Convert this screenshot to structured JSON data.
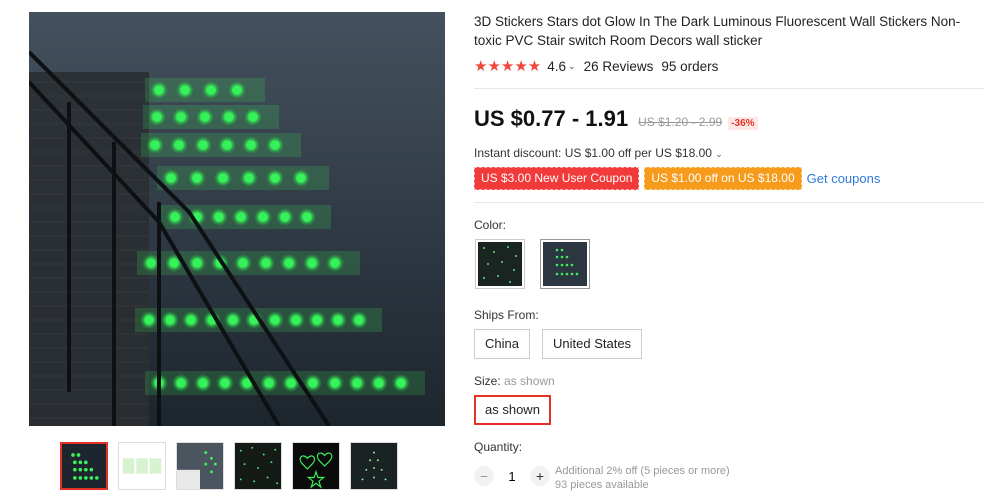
{
  "product": {
    "title": "3D Stickers Stars dot Glow In The Dark Luminous Fluorescent Wall Stickers Non-toxic PVC Stair switch Room Decors wall sticker",
    "stars": "★★★★★",
    "rating": "4.6",
    "reviews": "26 Reviews",
    "orders": "95 orders"
  },
  "price": {
    "current": "US $0.77 - 1.91",
    "original": "US $1.20 - 2.99",
    "discount": "-36%"
  },
  "instant_discount": "Instant discount: US $1.00 off per US $18.00",
  "coupons": {
    "new_user": "US $3.00 New User Coupon",
    "store": "US $1.00 off on US $18.00",
    "get_link": "Get coupons"
  },
  "color": {
    "label": "Color:",
    "options": [
      "dots-dark",
      "stairs-green"
    ],
    "selected": null
  },
  "ships_from": {
    "label": "Ships From:",
    "options": [
      "China",
      "United States"
    ]
  },
  "size": {
    "label": "Size:",
    "selected_hint": "as shown",
    "options": [
      "as shown"
    ]
  },
  "quantity": {
    "label": "Quantity:",
    "value": "1",
    "minus": "−",
    "plus": "+",
    "note_line1": "Additional 2% off (5 pieces or more)",
    "note_line2": "93 pieces available"
  },
  "colors": {
    "accent": "#e43225",
    "star": "#f0463c",
    "coupon_red": "#f33a3a",
    "coupon_orange": "#f79b1d",
    "link": "#2e7bd6",
    "glow": "#35f25a"
  },
  "gallery": {
    "thumbnails": [
      "stairs-glow",
      "sticker-sheet",
      "stairs-room",
      "dots-wall",
      "heart-star-shapes",
      "star-tree"
    ],
    "active_index": 0
  }
}
